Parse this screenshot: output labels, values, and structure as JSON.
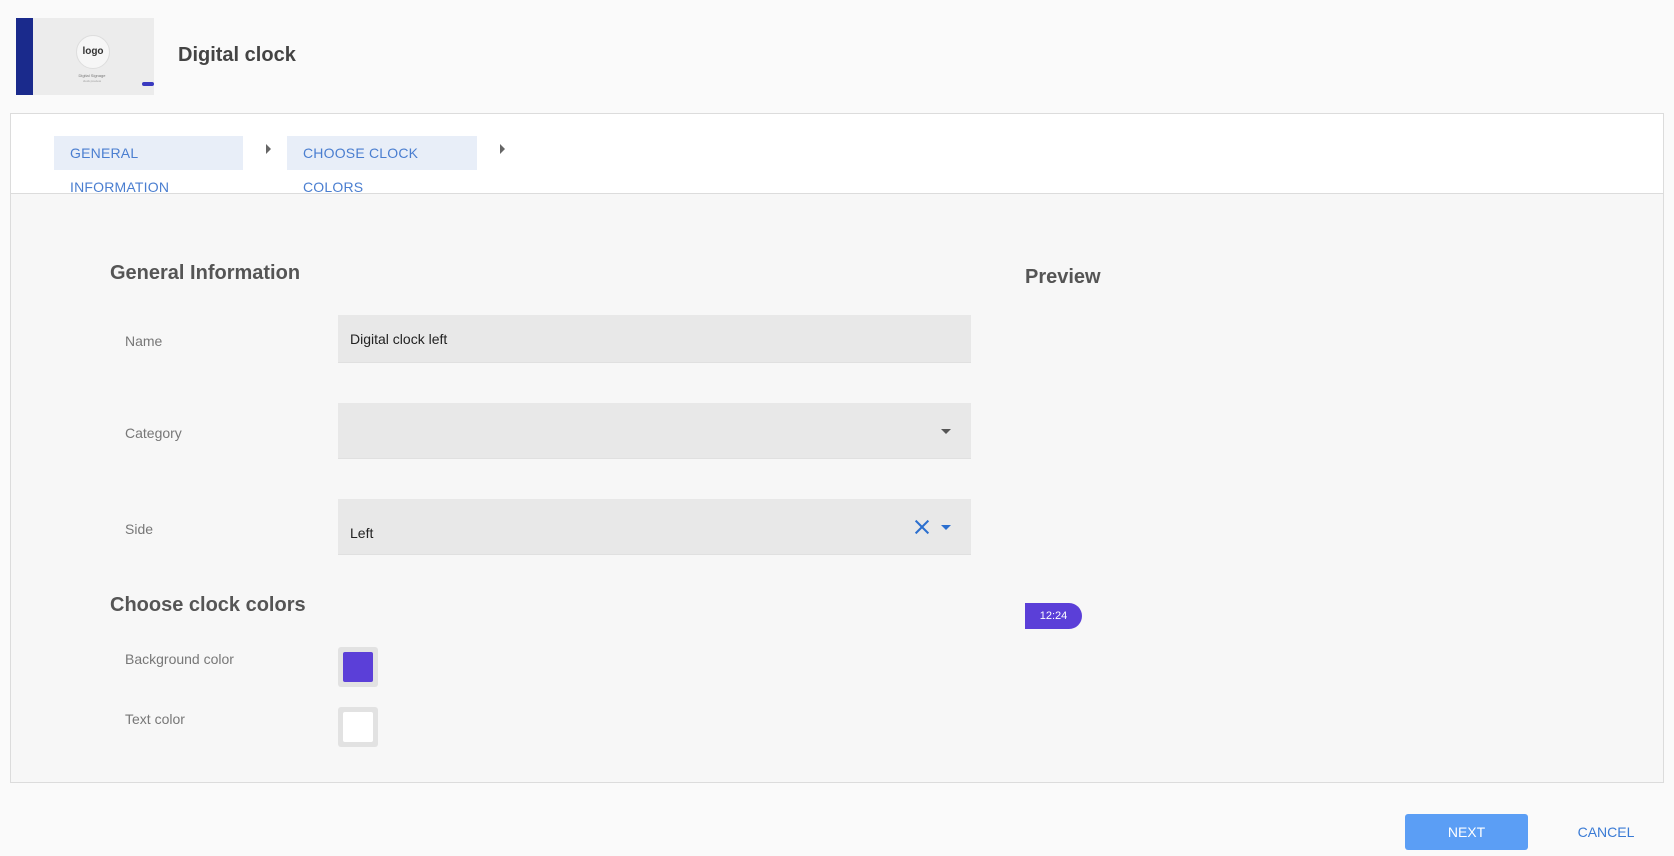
{
  "header": {
    "title": "Digital clock",
    "thumbnail": {
      "logo_text": "logo",
      "caption": "Digital Signage",
      "subcaption": "clock preview"
    }
  },
  "steps": [
    {
      "label": "GENERAL INFORMATION"
    },
    {
      "label": "CHOOSE CLOCK COLORS"
    }
  ],
  "general": {
    "title": "General Information",
    "name_label": "Name",
    "name_value": "Digital clock left",
    "category_label": "Category",
    "category_value": "",
    "side_label": "Side",
    "side_value": "Left"
  },
  "colors": {
    "title": "Choose clock colors",
    "background_label": "Background color",
    "background_value": "#5b3fd8",
    "text_label": "Text color",
    "text_value": "#ffffff"
  },
  "preview": {
    "title": "Preview",
    "clock_time": "12:24"
  },
  "footer": {
    "next_label": "NEXT",
    "cancel_label": "CANCEL"
  },
  "theme": {
    "accent": "#5b9ef5",
    "link": "#3a7bd5",
    "step_text": "#4a7ed0",
    "step_bg": "#e8eef8"
  }
}
